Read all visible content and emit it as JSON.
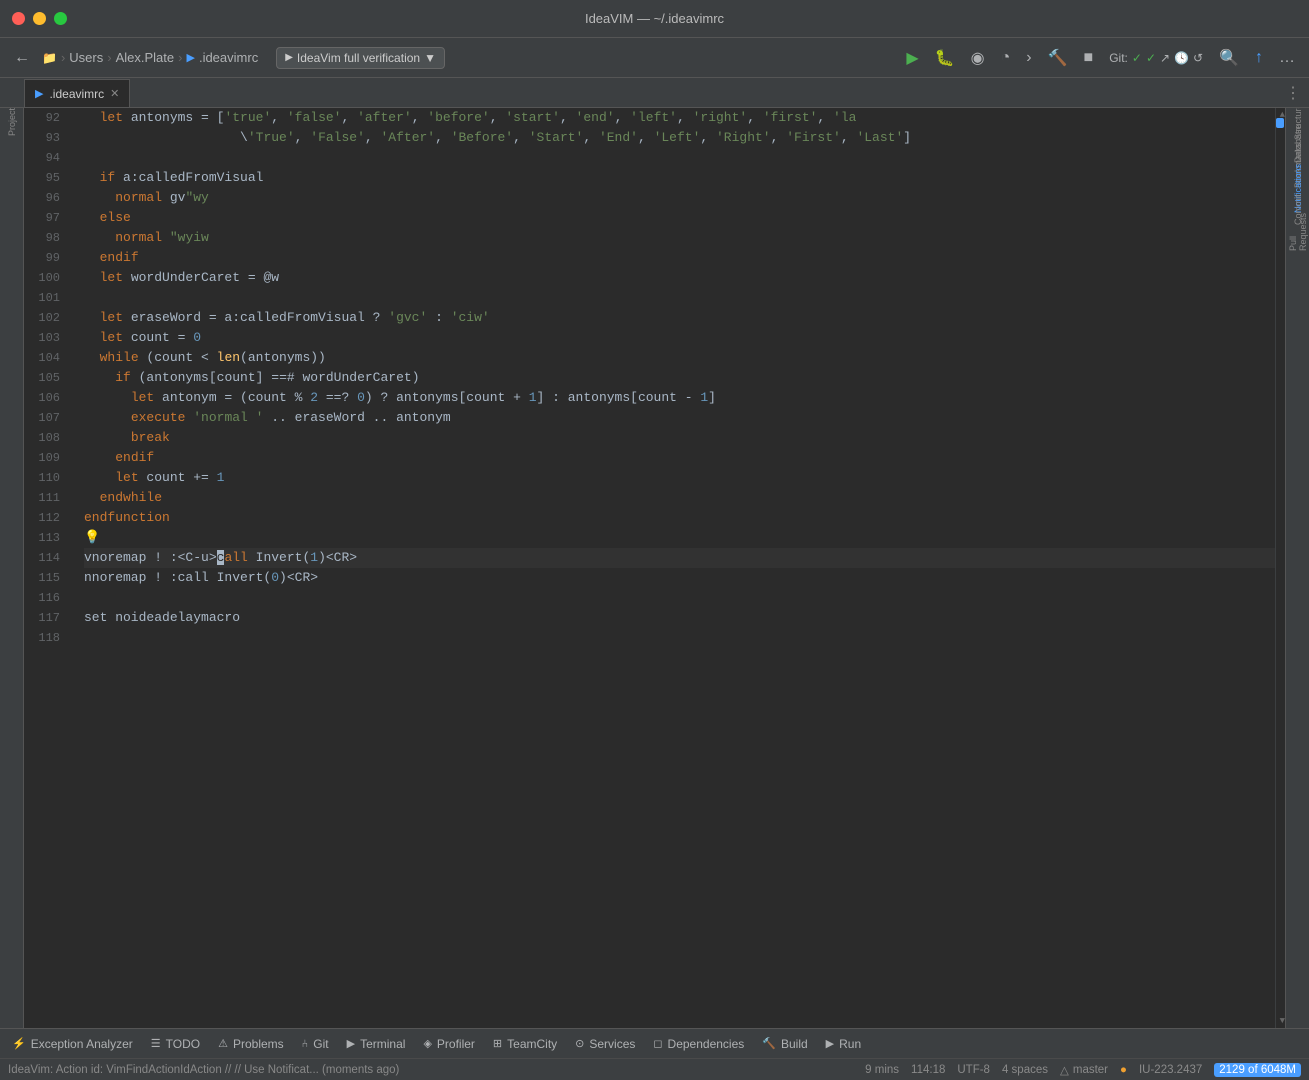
{
  "window": {
    "title": "IdeaVIM — ~/.ideavimrc"
  },
  "toolbar": {
    "breadcrumb": [
      "Users",
      "Alex.Plate",
      ".ideavimrc"
    ],
    "config_selector": "IdeaVim full verification",
    "git_label": "Git:",
    "back_btn": "←",
    "forward_btn": "→"
  },
  "tab": {
    "filename": ".ideavimrc",
    "is_active": true
  },
  "code": {
    "lines": [
      {
        "num": 92,
        "tokens": [
          {
            "t": "  ",
            "c": ""
          },
          {
            "t": "let",
            "c": "kw"
          },
          {
            "t": " antonyms = [",
            "c": "var"
          },
          {
            "t": "'true'",
            "c": "str"
          },
          {
            "t": ", ",
            "c": ""
          },
          {
            "t": "'false'",
            "c": "str"
          },
          {
            "t": ", ",
            "c": ""
          },
          {
            "t": "'after'",
            "c": "str"
          },
          {
            "t": ", ",
            "c": ""
          },
          {
            "t": "'before'",
            "c": "str"
          },
          {
            "t": ", ",
            "c": ""
          },
          {
            "t": "'start'",
            "c": "str"
          },
          {
            "t": ", ",
            "c": ""
          },
          {
            "t": "'end'",
            "c": "str"
          },
          {
            "t": ", ",
            "c": ""
          },
          {
            "t": "'left'",
            "c": "str"
          },
          {
            "t": ", ",
            "c": ""
          },
          {
            "t": "'right'",
            "c": "str"
          },
          {
            "t": ", ",
            "c": ""
          },
          {
            "t": "'first'",
            "c": "str"
          },
          {
            "t": ", ",
            "c": ""
          },
          {
            "t": "'la",
            "c": "str"
          }
        ]
      },
      {
        "num": 93,
        "tokens": [
          {
            "t": "                    ",
            "c": "dots"
          },
          {
            "t": "\\",
            "c": "var"
          },
          {
            "t": "'True'",
            "c": "str"
          },
          {
            "t": ", ",
            "c": ""
          },
          {
            "t": "'False'",
            "c": "str"
          },
          {
            "t": ", ",
            "c": ""
          },
          {
            "t": "'After'",
            "c": "str"
          },
          {
            "t": ", ",
            "c": ""
          },
          {
            "t": "'Before'",
            "c": "str"
          },
          {
            "t": ", ",
            "c": ""
          },
          {
            "t": "'Start'",
            "c": "str"
          },
          {
            "t": ", ",
            "c": ""
          },
          {
            "t": "'End'",
            "c": "str"
          },
          {
            "t": ", ",
            "c": ""
          },
          {
            "t": "'Left'",
            "c": "str"
          },
          {
            "t": ", ",
            "c": ""
          },
          {
            "t": "'Right'",
            "c": "str"
          },
          {
            "t": ", ",
            "c": ""
          },
          {
            "t": "'First'",
            "c": "str"
          },
          {
            "t": ", ",
            "c": ""
          },
          {
            "t": "'Last'",
            "c": "str"
          },
          {
            "t": "]",
            "c": ""
          }
        ]
      },
      {
        "num": 94,
        "tokens": []
      },
      {
        "num": 95,
        "tokens": [
          {
            "t": "  ",
            "c": ""
          },
          {
            "t": "if",
            "c": "kw"
          },
          {
            "t": " a:calledFromVisual",
            "c": "var"
          }
        ]
      },
      {
        "num": 96,
        "tokens": [
          {
            "t": "    ",
            "c": ""
          },
          {
            "t": "normal",
            "c": "kw"
          },
          {
            "t": " gv",
            "c": "var"
          },
          {
            "t": "\"wy",
            "c": "str"
          }
        ]
      },
      {
        "num": 97,
        "tokens": [
          {
            "t": "  ",
            "c": ""
          },
          {
            "t": "else",
            "c": "kw"
          }
        ]
      },
      {
        "num": 98,
        "tokens": [
          {
            "t": "    ",
            "c": ""
          },
          {
            "t": "normal",
            "c": "kw"
          },
          {
            "t": " ",
            "c": ""
          },
          {
            "t": "\"wyiw",
            "c": "str"
          }
        ]
      },
      {
        "num": 99,
        "tokens": [
          {
            "t": "  ",
            "c": ""
          },
          {
            "t": "endif",
            "c": "kw"
          }
        ]
      },
      {
        "num": 100,
        "tokens": [
          {
            "t": "  ",
            "c": ""
          },
          {
            "t": "let",
            "c": "kw"
          },
          {
            "t": " wordUnderCaret = @w",
            "c": "var"
          }
        ]
      },
      {
        "num": 101,
        "tokens": []
      },
      {
        "num": 102,
        "tokens": [
          {
            "t": "  ",
            "c": ""
          },
          {
            "t": "let",
            "c": "kw"
          },
          {
            "t": " eraseWord = a:calledFromVisual ? ",
            "c": "var"
          },
          {
            "t": "'gvc'",
            "c": "str"
          },
          {
            "t": " : ",
            "c": "var"
          },
          {
            "t": "'ciw'",
            "c": "str"
          }
        ]
      },
      {
        "num": 103,
        "tokens": [
          {
            "t": "  ",
            "c": ""
          },
          {
            "t": "let",
            "c": "kw"
          },
          {
            "t": " count = ",
            "c": "var"
          },
          {
            "t": "0",
            "c": "num"
          }
        ]
      },
      {
        "num": 104,
        "tokens": [
          {
            "t": "  ",
            "c": ""
          },
          {
            "t": "while",
            "c": "kw"
          },
          {
            "t": " (count < ",
            "c": "var"
          },
          {
            "t": "len",
            "c": "fn"
          },
          {
            "t": "(antonyms))",
            "c": "var"
          }
        ]
      },
      {
        "num": 105,
        "tokens": [
          {
            "t": "    ",
            "c": ""
          },
          {
            "t": "if",
            "c": "kw"
          },
          {
            "t": " (antonyms[count] ",
            "c": "var"
          },
          {
            "t": "==#",
            "c": "op"
          },
          {
            "t": " wordUnderCaret)",
            "c": "var"
          }
        ]
      },
      {
        "num": 106,
        "tokens": [
          {
            "t": "      ",
            "c": ""
          },
          {
            "t": "let",
            "c": "kw"
          },
          {
            "t": " antonym = (count % ",
            "c": "var"
          },
          {
            "t": "2",
            "c": "num"
          },
          {
            "t": " ==? ",
            "c": "op"
          },
          {
            "t": "0",
            "c": "num"
          },
          {
            "t": ") ? antonyms[count + ",
            "c": "var"
          },
          {
            "t": "1",
            "c": "num"
          },
          {
            "t": "] : antonyms[count - ",
            "c": "var"
          },
          {
            "t": "1",
            "c": "num"
          },
          {
            "t": "]",
            "c": "var"
          }
        ]
      },
      {
        "num": 107,
        "tokens": [
          {
            "t": "      ",
            "c": ""
          },
          {
            "t": "execute",
            "c": "kw"
          },
          {
            "t": " ",
            "c": ""
          },
          {
            "t": "'normal '",
            "c": "str"
          },
          {
            "t": " .. eraseWord .. antonym",
            "c": "var"
          }
        ]
      },
      {
        "num": 108,
        "tokens": [
          {
            "t": "      ",
            "c": ""
          },
          {
            "t": "break",
            "c": "kw"
          }
        ]
      },
      {
        "num": 109,
        "tokens": [
          {
            "t": "    ",
            "c": ""
          },
          {
            "t": "endif",
            "c": "kw"
          }
        ]
      },
      {
        "num": 110,
        "tokens": [
          {
            "t": "    ",
            "c": ""
          },
          {
            "t": "let",
            "c": "kw"
          },
          {
            "t": " count += ",
            "c": "var"
          },
          {
            "t": "1",
            "c": "num"
          }
        ]
      },
      {
        "num": 111,
        "tokens": [
          {
            "t": "  ",
            "c": ""
          },
          {
            "t": "endwhile",
            "c": "kw"
          }
        ]
      },
      {
        "num": 112,
        "tokens": [
          {
            "t": "endfunction",
            "c": "kw"
          }
        ]
      },
      {
        "num": 113,
        "tokens": [
          {
            "t": "💡",
            "c": "lightbulb"
          }
        ]
      },
      {
        "num": 114,
        "tokens": [
          {
            "t": "vnoremap ! :<C-u>",
            "c": "var"
          },
          {
            "t": "call",
            "c": "kw"
          },
          {
            "t": " Invert(",
            "c": "var"
          },
          {
            "t": "1",
            "c": "num"
          },
          {
            "t": ")<CR>",
            "c": "var"
          }
        ],
        "active": true,
        "cursor_at": 16
      },
      {
        "num": 115,
        "tokens": [
          {
            "t": "nnoremap ! :call Invert(",
            "c": "var"
          },
          {
            "t": "0",
            "c": "num"
          },
          {
            "t": ")<CR>",
            "c": "var"
          }
        ]
      },
      {
        "num": 116,
        "tokens": []
      },
      {
        "num": 117,
        "tokens": [
          {
            "t": "set noideadelaymacro",
            "c": "var"
          }
        ]
      },
      {
        "num": 118,
        "tokens": []
      }
    ]
  },
  "right_sidebar": {
    "items": [
      "Structure",
      "Database",
      "Bookmarks",
      "Notifications",
      "Commit",
      "Pull Requests"
    ]
  },
  "bottom_tools": {
    "items": [
      {
        "icon": "⚡",
        "label": "Exception Analyzer"
      },
      {
        "icon": "☰",
        "label": "TODO"
      },
      {
        "icon": "⚠",
        "label": "Problems"
      },
      {
        "icon": "⑃",
        "label": "Git"
      },
      {
        "icon": "▶",
        "label": "Terminal"
      },
      {
        "icon": "◈",
        "label": "Profiler"
      },
      {
        "icon": "⊞",
        "label": "TeamCity"
      },
      {
        "icon": "⊙",
        "label": "Services"
      },
      {
        "icon": "◻",
        "label": "Dependencies"
      },
      {
        "icon": "🔨",
        "label": "Build"
      },
      {
        "icon": "▶",
        "label": "Run"
      }
    ]
  },
  "status_bar": {
    "message": "IdeaVim: Action id: VimFindActionIdAction // // Use Notificat... (moments ago)",
    "time": "9 mins",
    "position": "114:18",
    "encoding": "UTF-8",
    "spaces": "4 spaces",
    "branch": "master",
    "plugin_version": "IU-223.2437",
    "line_count": "2129 of 6048M"
  }
}
